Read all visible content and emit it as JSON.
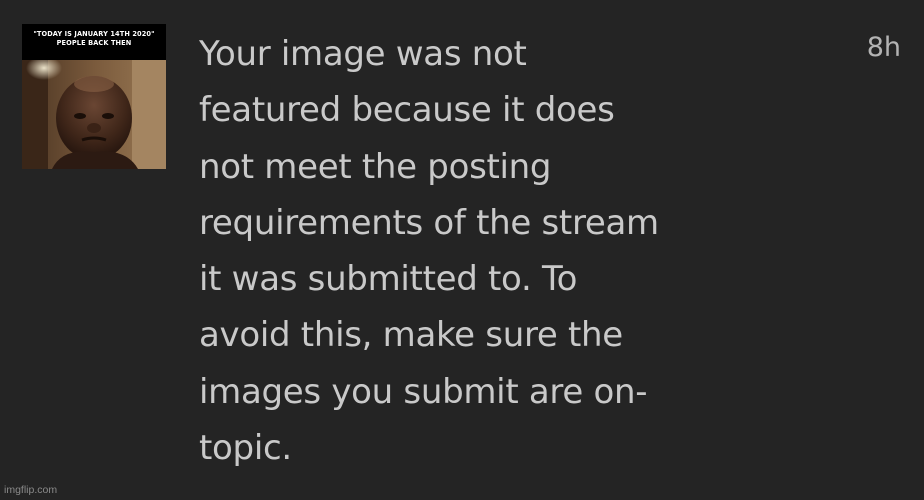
{
  "notification": {
    "thumbnail": {
      "caption_lines": [
        "\"TODAY IS JANUARY 14TH 2020\"",
        "PEOPLE BACK THEN"
      ]
    },
    "message_lines": [
      "Your image was not",
      "featured because it does",
      "not meet the posting",
      "requirements of the stream",
      "it was submitted to. To",
      "avoid this, make sure the",
      "images you submit are on-",
      "topic."
    ],
    "time": "8h"
  },
  "watermark": "imgflip.com",
  "colors": {
    "background": "#242424",
    "message_text": "#c9c9c9",
    "timestamp_text": "#b3b3b3",
    "watermark_text": "#8a8a8a"
  }
}
